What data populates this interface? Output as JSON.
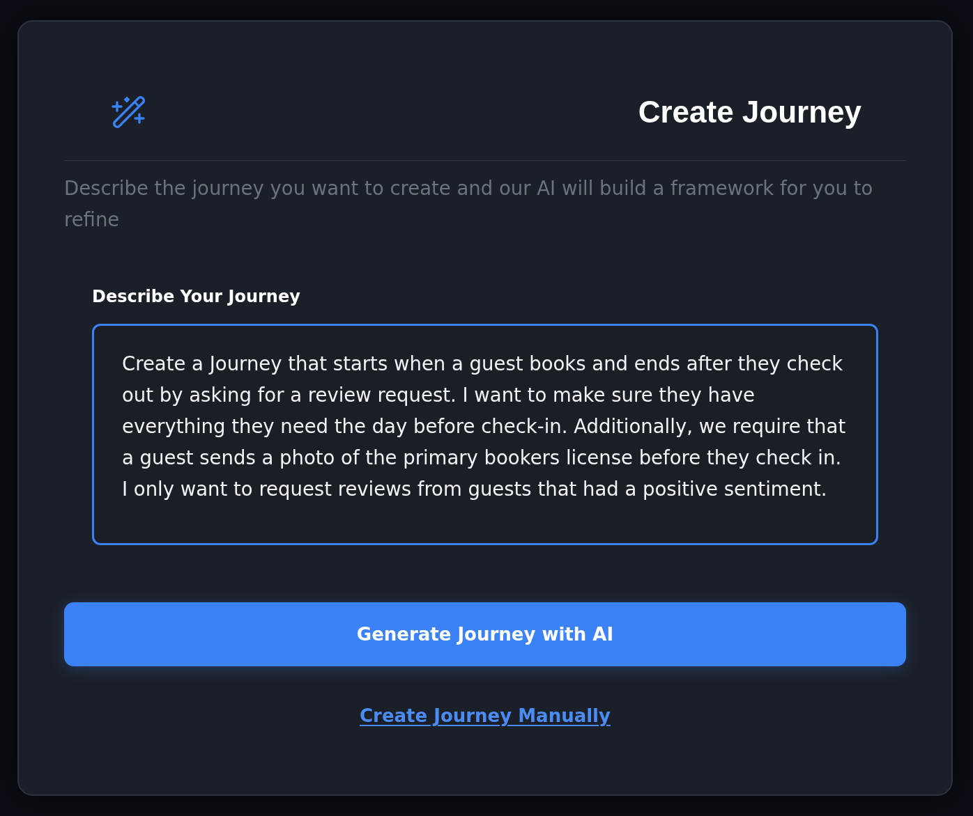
{
  "dialog": {
    "title": "Create Journey",
    "description": "Describe the journey you want to create and our AI will build a framework for you to refine"
  },
  "form": {
    "label": "Describe Your Journey",
    "value": "Create a Journey that starts when a guest books and ends after they check out by asking for a review request. I want to make sure they have everything they need the day before check-in. Additionally, we require that a guest sends a photo of the primary bookers license before they check in. I only want to request reviews from guests that had a positive sentiment.",
    "focused": true
  },
  "primary_button": "Generate Journey with AI",
  "link": "Create Journey Manually"
}
